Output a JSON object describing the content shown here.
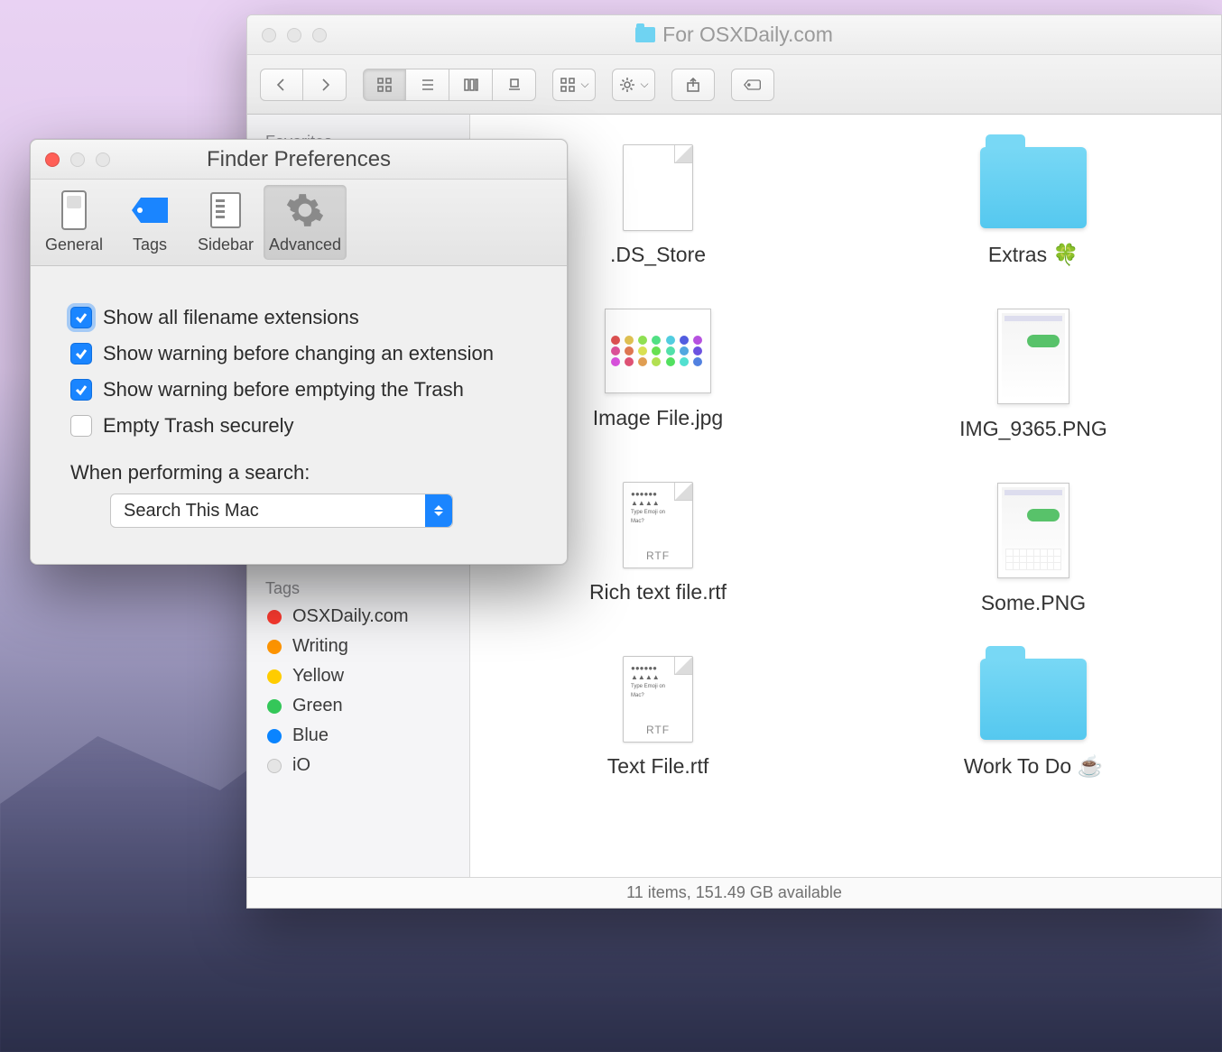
{
  "finder": {
    "title": "For OSXDaily.com",
    "sidebar": {
      "favorites_header": "Favorites",
      "tags_header": "Tags",
      "tags": [
        {
          "label": "OSXDaily.com",
          "color": "#ff3b30"
        },
        {
          "label": "Writing",
          "color": "#ff9500"
        },
        {
          "label": "Yellow",
          "color": "#ffcc00"
        },
        {
          "label": "Green",
          "color": "#34c759"
        },
        {
          "label": "Blue",
          "color": "#0a84ff"
        },
        {
          "label": "iO",
          "color": "#e5e5e5"
        }
      ]
    },
    "files": [
      {
        "label": ".DS_Store",
        "kind": "blank"
      },
      {
        "label": "Extras 🍀",
        "kind": "folder"
      },
      {
        "label": "Image File.jpg",
        "kind": "emojigrid"
      },
      {
        "label": "IMG_9365.PNG",
        "kind": "screenshot"
      },
      {
        "label": "Rich text file.rtf",
        "kind": "rtf"
      },
      {
        "label": "Some.PNG",
        "kind": "screenshot-kbd"
      },
      {
        "label": "Text File.rtf",
        "kind": "rtf"
      },
      {
        "label": "Work To Do ☕",
        "kind": "folder"
      }
    ],
    "status": "11 items, 151.49 GB available"
  },
  "prefs": {
    "title": "Finder Preferences",
    "tabs": [
      {
        "label": "General"
      },
      {
        "label": "Tags"
      },
      {
        "label": "Sidebar"
      },
      {
        "label": "Advanced"
      }
    ],
    "checks": [
      {
        "label": "Show all filename extensions",
        "checked": true,
        "highlight": true
      },
      {
        "label": "Show warning before changing an extension",
        "checked": true
      },
      {
        "label": "Show warning before emptying the Trash",
        "checked": true
      },
      {
        "label": "Empty Trash securely",
        "checked": false
      }
    ],
    "search_label": "When performing a search:",
    "search_value": "Search This Mac"
  }
}
